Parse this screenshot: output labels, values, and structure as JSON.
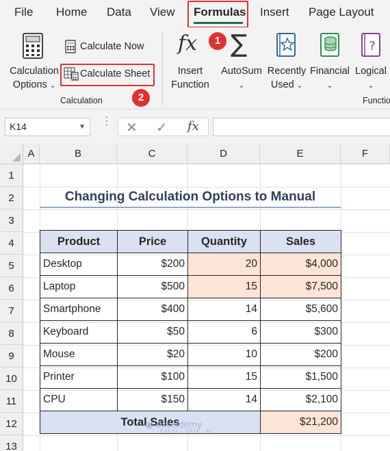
{
  "ribbon_tabs": [
    "File",
    "Home",
    "Data",
    "View",
    "Formulas",
    "Insert",
    "Page Layout"
  ],
  "active_tab": "Formulas",
  "calculation_group": {
    "options_label_line1": "Calculation",
    "options_label_line2": "Options",
    "calc_now_label": "Calculate Now",
    "calc_sheet_label": "Calculate Sheet",
    "group_label": "Calculation"
  },
  "function_group": {
    "insert_function_line1": "Insert",
    "insert_function_line2": "Function",
    "autosum_label": "AutoSum",
    "recently_used_line1": "Recently",
    "recently_used_line2": "Used",
    "financial_label": "Financial",
    "logical_label": "Logical",
    "group_label_partial": "Functio"
  },
  "badges": {
    "step1": "1",
    "step2": "2"
  },
  "formula_bar": {
    "name_box": "K14",
    "fx_symbol": "fx",
    "formula": ""
  },
  "columns": [
    "A",
    "B",
    "C",
    "D",
    "E",
    "F"
  ],
  "rows": [
    "1",
    "2",
    "3",
    "4",
    "5",
    "6",
    "7",
    "8",
    "9",
    "10",
    "11",
    "12",
    "13"
  ],
  "sheet": {
    "title": "Changing Calculation Options to Manual",
    "headers": [
      "Product",
      "Price",
      "Quantity",
      "Sales"
    ],
    "items": [
      {
        "product": "Desktop",
        "price": "$200",
        "quantity": "20",
        "sales": "$4,000"
      },
      {
        "product": "Laptop",
        "price": "$500",
        "quantity": "15",
        "sales": "$7,500"
      },
      {
        "product": "Smartphone",
        "price": "$400",
        "quantity": "14",
        "sales": "$5,600"
      },
      {
        "product": "Keyboard",
        "price": "$50",
        "quantity": "6",
        "sales": "$300"
      },
      {
        "product": "Mouse",
        "price": "$20",
        "quantity": "10",
        "sales": "$200"
      },
      {
        "product": "Printer",
        "price": "$100",
        "quantity": "15",
        "sales": "$1,500"
      },
      {
        "product": "CPU",
        "price": "$150",
        "quantity": "14",
        "sales": "$2,100"
      }
    ],
    "total_label": "Total Sales",
    "total_value": "$21,200"
  },
  "watermark": {
    "name": "exceldemy",
    "tagline": "EXCEL · DATA · BI"
  },
  "colors": {
    "accent_green": "#1e7145",
    "highlight_red": "#e03131",
    "header_fill": "#d9e1f2",
    "peach_fill": "#fce4d6"
  },
  "icons": [
    "calculator-icon",
    "calculator-small-icon",
    "calculate-sheet-icon",
    "fx-icon",
    "sigma-icon",
    "star-book-icon",
    "database-icon",
    "question-book-icon"
  ]
}
